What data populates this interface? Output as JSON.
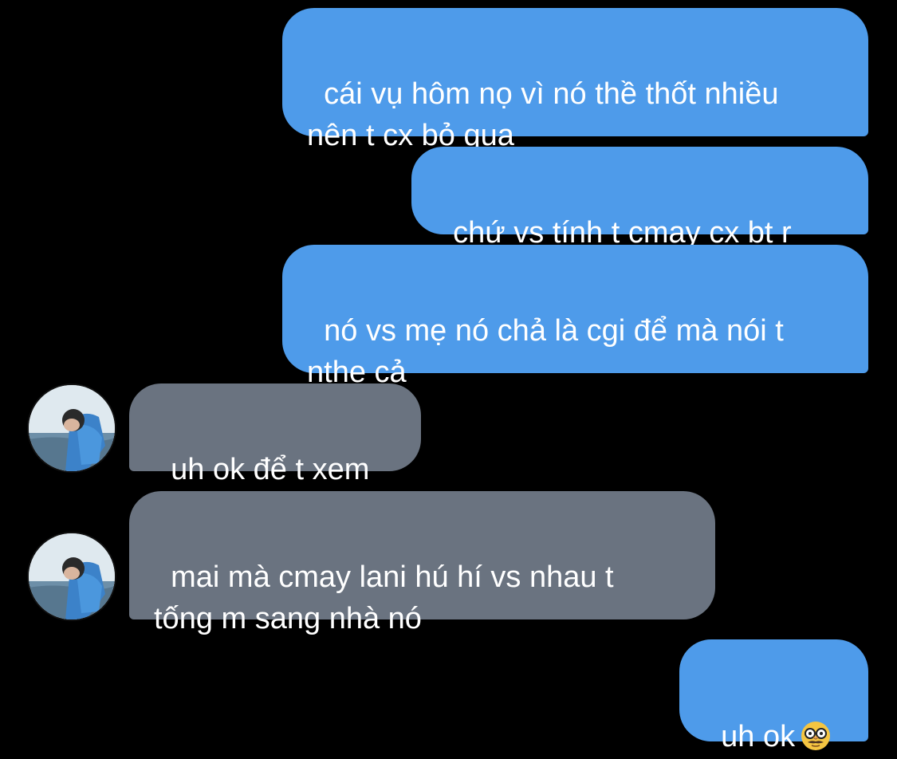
{
  "colors": {
    "background": "#000000",
    "sent_bubble": "#4e9bea",
    "received_bubble": "#6a7380",
    "text": "#ffffff"
  },
  "messages": [
    {
      "direction": "sent",
      "text": "cái vụ hôm nọ vì nó thề thốt nhiều\nnên t cx bỏ qua"
    },
    {
      "direction": "sent",
      "text": "chứ vs tính t cmay cx bt r"
    },
    {
      "direction": "sent",
      "text": "nó vs mẹ nó chả là cgi để mà nói t\nnthe cả"
    },
    {
      "direction": "received",
      "text": "uh ok để t xem",
      "avatar": "contact-avatar"
    },
    {
      "direction": "received",
      "text": "mai mà cmay lani hú hí vs nhau t\ntống m sang nhà nó",
      "avatar": "contact-avatar"
    },
    {
      "direction": "sent",
      "text": "uh ok",
      "emoji": "disguised-face-emoji"
    }
  ]
}
